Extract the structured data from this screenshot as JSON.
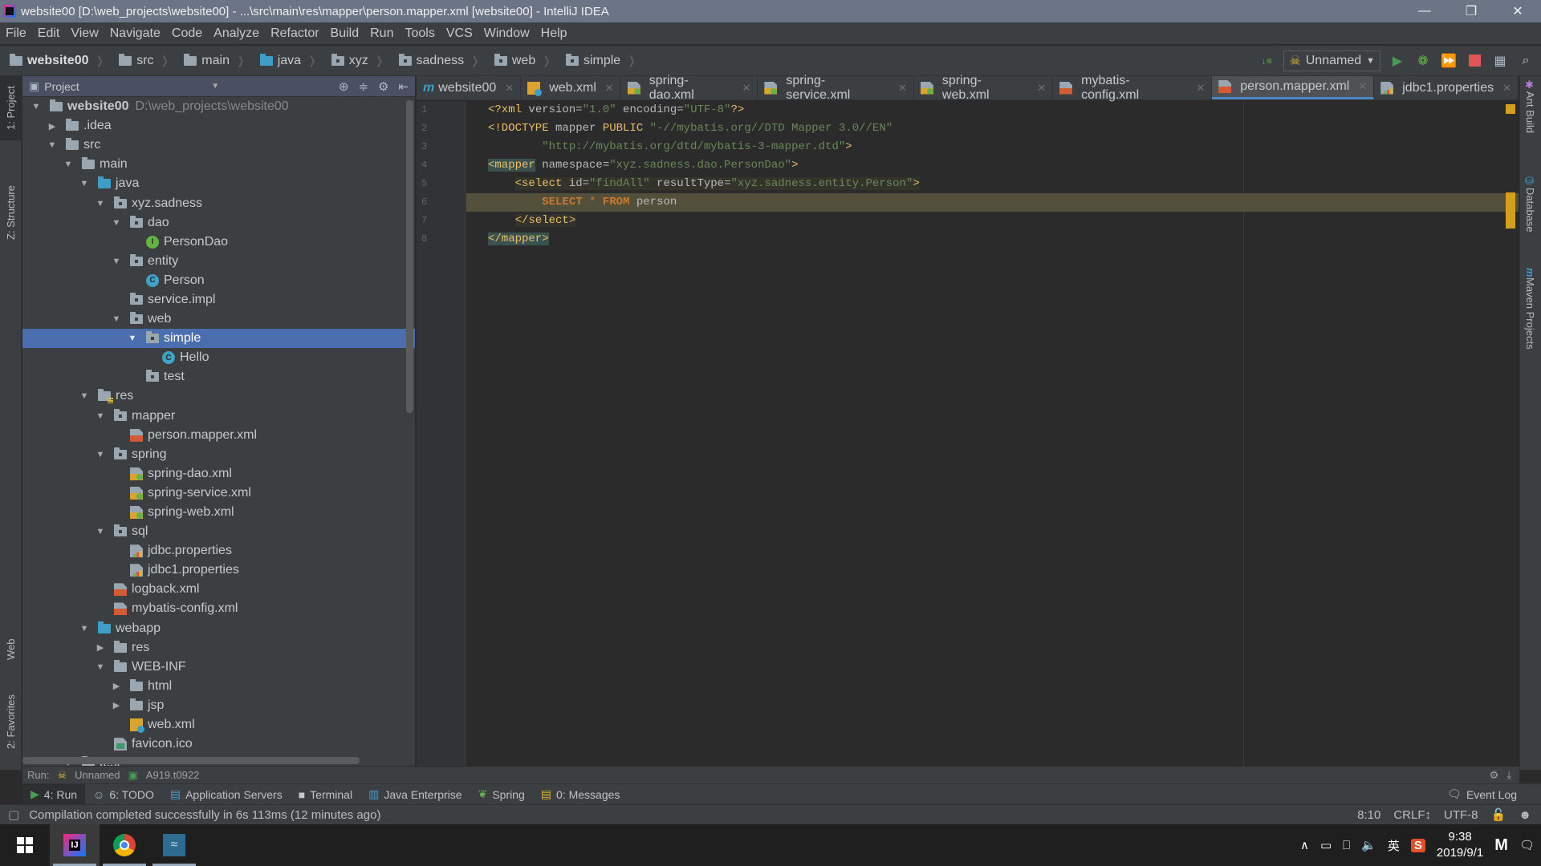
{
  "window": {
    "title": "website00 [D:\\web_projects\\website00] - ...\\src\\main\\res\\mapper\\person.mapper.xml [website00] - IntelliJ IDEA",
    "controls": [
      "minimize",
      "restore",
      "close"
    ]
  },
  "menu": [
    "File",
    "Edit",
    "View",
    "Navigate",
    "Code",
    "Analyze",
    "Refactor",
    "Build",
    "Run",
    "Tools",
    "VCS",
    "Window",
    "Help"
  ],
  "breadcrumb": [
    "website00",
    "src",
    "main",
    "java",
    "xyz",
    "sadness",
    "web",
    "simple"
  ],
  "toolbar": {
    "run_config": "Unnamed",
    "icons": [
      "sort-icon",
      "run-icon",
      "debug-icon",
      "coverage-icon",
      "stop-icon",
      "project-structure-icon",
      "search-icon"
    ]
  },
  "left_strip": {
    "tabs": [
      "1: Project",
      "Z: Structure",
      "Web",
      "2: Favorites"
    ]
  },
  "right_strip": {
    "tabs": [
      "Ant Build",
      "Database",
      "Maven Projects"
    ]
  },
  "project_panel": {
    "title": "Project",
    "root_path": "D:\\web_projects\\website00",
    "tree": [
      {
        "label": "website00",
        "depth": 0,
        "arrow": "down",
        "icon": "module",
        "bold": true
      },
      {
        "label": ".idea",
        "depth": 1,
        "arrow": "right",
        "icon": "folder"
      },
      {
        "label": "src",
        "depth": 1,
        "arrow": "down",
        "icon": "folder"
      },
      {
        "label": "main",
        "depth": 2,
        "arrow": "down",
        "icon": "folder"
      },
      {
        "label": "java",
        "depth": 3,
        "arrow": "down",
        "icon": "folder-blue"
      },
      {
        "label": "xyz.sadness",
        "depth": 4,
        "arrow": "down",
        "icon": "package"
      },
      {
        "label": "dao",
        "depth": 5,
        "arrow": "down",
        "icon": "package"
      },
      {
        "label": "PersonDao",
        "depth": 6,
        "arrow": "",
        "icon": "interface"
      },
      {
        "label": "entity",
        "depth": 5,
        "arrow": "down",
        "icon": "package"
      },
      {
        "label": "Person",
        "depth": 6,
        "arrow": "",
        "icon": "class"
      },
      {
        "label": "service.impl",
        "depth": 5,
        "arrow": "",
        "icon": "package"
      },
      {
        "label": "web",
        "depth": 5,
        "arrow": "down",
        "icon": "package"
      },
      {
        "label": "simple",
        "depth": 6,
        "arrow": "down",
        "icon": "package",
        "selected": true
      },
      {
        "label": "Hello",
        "depth": 7,
        "arrow": "",
        "icon": "class"
      },
      {
        "label": "test",
        "depth": 6,
        "arrow": "",
        "icon": "package"
      },
      {
        "label": "res",
        "depth": 3,
        "arrow": "down",
        "icon": "res-folder"
      },
      {
        "label": "mapper",
        "depth": 4,
        "arrow": "down",
        "icon": "package"
      },
      {
        "label": "person.mapper.xml",
        "depth": 5,
        "arrow": "",
        "icon": "xml"
      },
      {
        "label": "spring",
        "depth": 4,
        "arrow": "down",
        "icon": "package"
      },
      {
        "label": "spring-dao.xml",
        "depth": 5,
        "arrow": "",
        "icon": "spring"
      },
      {
        "label": "spring-service.xml",
        "depth": 5,
        "arrow": "",
        "icon": "spring"
      },
      {
        "label": "spring-web.xml",
        "depth": 5,
        "arrow": "",
        "icon": "spring"
      },
      {
        "label": "sql",
        "depth": 4,
        "arrow": "down",
        "icon": "package"
      },
      {
        "label": "jdbc.properties",
        "depth": 5,
        "arrow": "",
        "icon": "props"
      },
      {
        "label": "jdbc1.properties",
        "depth": 5,
        "arrow": "",
        "icon": "props"
      },
      {
        "label": "logback.xml",
        "depth": 4,
        "arrow": "",
        "icon": "xml"
      },
      {
        "label": "mybatis-config.xml",
        "depth": 4,
        "arrow": "",
        "icon": "xml"
      },
      {
        "label": "webapp",
        "depth": 3,
        "arrow": "down",
        "icon": "folder-web"
      },
      {
        "label": "res",
        "depth": 4,
        "arrow": "right",
        "icon": "folder"
      },
      {
        "label": "WEB-INF",
        "depth": 4,
        "arrow": "down",
        "icon": "folder"
      },
      {
        "label": "html",
        "depth": 5,
        "arrow": "right",
        "icon": "folder"
      },
      {
        "label": "jsp",
        "depth": 5,
        "arrow": "right",
        "icon": "folder"
      },
      {
        "label": "web.xml",
        "depth": 5,
        "arrow": "",
        "icon": "webxml"
      },
      {
        "label": "favicon.ico",
        "depth": 4,
        "arrow": "",
        "icon": "ico"
      },
      {
        "label": "test",
        "depth": 2,
        "arrow": "down",
        "icon": "folder"
      }
    ]
  },
  "editor": {
    "tabs": [
      {
        "label": "website00",
        "icon": "maven",
        "active": false
      },
      {
        "label": "web.xml",
        "icon": "webxml",
        "active": false
      },
      {
        "label": "spring-dao.xml",
        "icon": "spring",
        "active": false
      },
      {
        "label": "spring-service.xml",
        "icon": "spring",
        "active": false
      },
      {
        "label": "spring-web.xml",
        "icon": "spring",
        "active": false
      },
      {
        "label": "mybatis-config.xml",
        "icon": "xml",
        "active": false
      },
      {
        "label": "person.mapper.xml",
        "icon": "xml",
        "active": true
      },
      {
        "label": "jdbc1.properties",
        "icon": "props",
        "active": false
      }
    ],
    "line_numbers": [
      "1",
      "2",
      "3",
      "4",
      "5",
      "6",
      "7",
      "8"
    ],
    "code": {
      "l1": {
        "open": "<?xml",
        "attrs": " version=",
        "v1": "\"1.0\"",
        "a2": " encoding=",
        "v2": "\"UTF-8\"",
        "close": "?>"
      },
      "l2": {
        "open": "<!DOCTYPE",
        "mid": " mapper ",
        "kw": "PUBLIC",
        "str": " \"-//mybatis.org//DTD Mapper 3.0//EN\""
      },
      "l3": {
        "indent": "        ",
        "str": "\"http://mybatis.org/dtd/mybatis-3-mapper.dtd\"",
        "close": ">"
      },
      "l4": {
        "open": "<mapper",
        "attr": " namespace=",
        "val": "\"xyz.sadness.dao.PersonDao\"",
        "close": ">"
      },
      "l5": {
        "indent": "    ",
        "open": "<select",
        "a1": " id=",
        "v1": "\"findAll\"",
        "a2": " resultType=",
        "v2": "\"xyz.sadness.entity.Person\"",
        "close": ">"
      },
      "l6": {
        "indent": "        ",
        "kw1": "SELECT",
        "star": " * ",
        "kw2": "FROM",
        "table": " person"
      },
      "l7": {
        "indent": "    ",
        "close": "</select>"
      },
      "l8": {
        "close": "</mapper>"
      }
    }
  },
  "run_strip": {
    "label": "Run:",
    "config": "Unnamed",
    "session": "A919.t0922"
  },
  "tool_windows": [
    {
      "label": "4: Run",
      "icon": "run-icon",
      "active": true
    },
    {
      "label": "6: TODO",
      "icon": "todo-icon"
    },
    {
      "label": "Application Servers",
      "icon": "app-servers-icon"
    },
    {
      "label": "Terminal",
      "icon": "terminal-icon"
    },
    {
      "label": "Java Enterprise",
      "icon": "java-enterprise-icon"
    },
    {
      "label": "Spring",
      "icon": "spring-icon"
    },
    {
      "label": "0: Messages",
      "icon": "messages-icon"
    }
  ],
  "event_log": "Event Log",
  "status": {
    "message": "Compilation completed successfully in 6s 113ms (12 minutes ago)",
    "position": "8:10",
    "line_sep": "CRLF↕",
    "encoding": "UTF-8"
  },
  "taskbar": {
    "apps": [
      "IntelliJ IDEA",
      "Google Chrome",
      "MySQL Workbench"
    ],
    "ime": "英",
    "time": "9:38",
    "date": "2019/9/1"
  },
  "colors": {
    "selection": "#4b6eaf",
    "active_tab_underline": "#4a88c7",
    "line_highlight": "#52503a",
    "xml_tag": "#e8bf6a",
    "xml_string": "#6a8759",
    "sql_keyword": "#cc7832",
    "marker": "#d4a019"
  }
}
